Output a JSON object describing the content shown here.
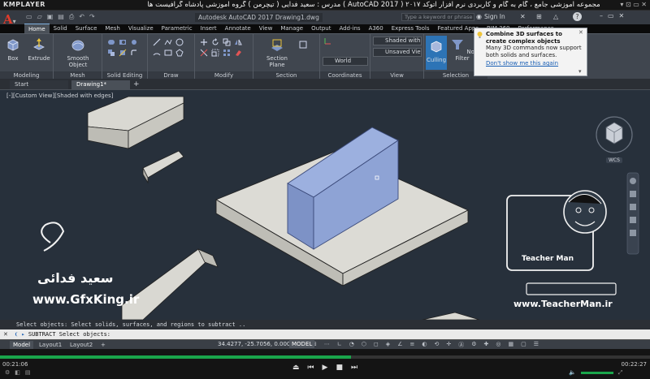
{
  "player": {
    "logo": "KMPLAYER",
    "title": "مجموعه آموزشی جامع ، گام به گام و کاربردی نرم افزار  اتوکد ۲۰۱۷  ( AutoCAD 2017 )  مدرس : سعید فدایی ( تیچرمن ) گروه آموزشی پادشاه گرافیست ها",
    "window_controls": "▾ ⊡ ▭ ✕",
    "time_elapsed": "00:21:06",
    "time_total": "00:22:27",
    "progress": 0.54
  },
  "acad": {
    "title": "Autodesk AutoCAD 2017    Drawing1.dwg",
    "search_placeholder": "Type a keyword or phrase",
    "sign_in": "Sign In",
    "help": "?"
  },
  "tabs": [
    "Home",
    "Solid",
    "Surface",
    "Mesh",
    "Visualize",
    "Parametric",
    "Insert",
    "Annotate",
    "View",
    "Manage",
    "Output",
    "Add-ins",
    "A360",
    "Express Tools",
    "Featured Apps",
    "BIM 360",
    "Performance"
  ],
  "ribbon": {
    "modeling_label": "Modeling",
    "mesh_label": "Mesh",
    "solid_editing_label": "Solid Editing",
    "draw_label": "Draw",
    "modify_label": "Modify",
    "section_label": "Section",
    "coordinates_label": "Coordinates",
    "view_label": "View",
    "selection_label": "Selection",
    "box": "Box",
    "extrude": "Extrude",
    "smooth_object": "Smooth Object",
    "section_plane": "Section Plane",
    "culling": "Culling",
    "no_filter": "No Filter",
    "visual_style": "Shaded with e...",
    "saved_view": "Unsaved View",
    "ucs": "World"
  },
  "tooltip": {
    "title": "Combine 3D surfaces to create complex objects",
    "body": "Many 3D commands now support both solids and surfaces.",
    "link": "Don't show me this again"
  },
  "file_tabs": [
    "Start",
    "Drawing1*"
  ],
  "viewport_label": "[-][Custom View][Shaded with edges]",
  "viewcube_label": "WCS",
  "command": {
    "history": "Select objects:  Select solids, surfaces, and regions to subtract ..",
    "current": "SUBTRACT Select objects:"
  },
  "layouts": [
    "Model",
    "Layout1",
    "Layout2"
  ],
  "status": {
    "coords": "34.4277, -25.7056, 0.0000",
    "model": "MODEL"
  },
  "watermarks": {
    "gfxking": "www.GfxKing.ir",
    "teacherman": "www.TeacherMan.ir",
    "teacher_badge": "Teacher Man",
    "name": "سعید فدائی"
  },
  "colors": {
    "accent": "#1aa54b",
    "viewport_bg": "#27303b",
    "box_face": "#8fa3d4"
  }
}
